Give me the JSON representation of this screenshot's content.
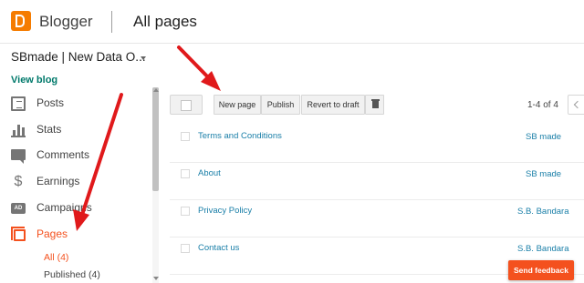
{
  "header": {
    "brand": "Blogger",
    "section_title": "All pages",
    "logo_icon": "blogger-logo-icon",
    "accent_color": "#f57c00"
  },
  "sidebar": {
    "blog_name": "SBmade | New Data O...",
    "view_blog": "View blog",
    "items": [
      {
        "label": "Posts",
        "icon": "posts-icon"
      },
      {
        "label": "Stats",
        "icon": "stats-icon"
      },
      {
        "label": "Comments",
        "icon": "comments-icon"
      },
      {
        "label": "Earnings",
        "icon": "dollar-icon"
      },
      {
        "label": "Campaigns",
        "icon": "campaigns-icon"
      },
      {
        "label": "Pages",
        "icon": "pages-icon",
        "active": true
      }
    ],
    "sub_items": [
      {
        "label": "All (4)",
        "active": true
      },
      {
        "label": "Published (4)"
      }
    ]
  },
  "toolbar": {
    "new_page": "New page",
    "publish": "Publish",
    "revert_to_draft": "Revert to draft",
    "delete_icon": "trash-icon",
    "pagination": "1-4 of 4"
  },
  "pages": [
    {
      "title": "Terms and Conditions",
      "author": "SB made"
    },
    {
      "title": "About",
      "author": "SB made"
    },
    {
      "title": "Privacy Policy",
      "author": "S.B. Bandara"
    },
    {
      "title": "Contact us",
      "author": "S.B. Bandara"
    }
  ],
  "feedback": {
    "label": "Send feedback",
    "color": "#f4511e"
  },
  "annotation_color": "#e0191b"
}
